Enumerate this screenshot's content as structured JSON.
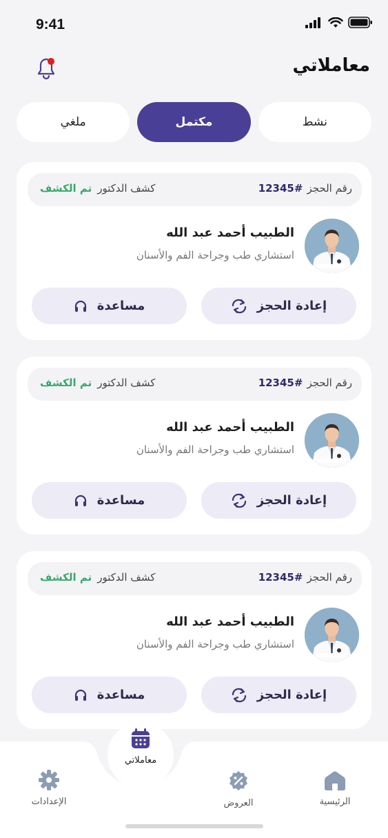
{
  "status": {
    "time": "9:41"
  },
  "header": {
    "title": "معاملاتي"
  },
  "tabs": [
    {
      "label": "نشط"
    },
    {
      "label": "مكتمل"
    },
    {
      "label": "ملغي"
    }
  ],
  "cards": [
    {
      "booking_label": "رقم الحجز",
      "booking_number": "#12345",
      "exam_type": "كشف الدكتور",
      "exam_status": "تم الكشف",
      "doctor_name": "الطبيب أحمد عبد الله",
      "doctor_specialty": "استشاري طب وجراحة الفم والأسنان",
      "rebook_label": "إعادة الحجز",
      "help_label": "مساعدة"
    },
    {
      "booking_label": "رقم الحجز",
      "booking_number": "#12345",
      "exam_type": "كشف الدكتور",
      "exam_status": "تم الكشف",
      "doctor_name": "الطبيب أحمد عبد الله",
      "doctor_specialty": "استشاري طب وجراحة الفم والأسنان",
      "rebook_label": "إعادة الحجز",
      "help_label": "مساعدة"
    },
    {
      "booking_label": "رقم الحجز",
      "booking_number": "#12345",
      "exam_type": "كشف الدكتور",
      "exam_status": "تم الكشف",
      "doctor_name": "الطبيب أحمد عبد الله",
      "doctor_specialty": "استشاري طب وجراحة الفم والأسنان",
      "rebook_label": "إعادة الحجز",
      "help_label": "مساعدة"
    }
  ],
  "nav": {
    "home": "الرئيسية",
    "offers": "العروض",
    "transactions": "معاملاتي",
    "settings": "الإعدادات"
  },
  "colors": {
    "accent": "#4a3f96",
    "success": "#3aa76d",
    "notification": "#e01e1e"
  },
  "icons": [
    "bell-icon",
    "refresh-icon",
    "headphones-icon",
    "home-icon",
    "discount-icon",
    "calendar-icon",
    "gear-icon"
  ]
}
